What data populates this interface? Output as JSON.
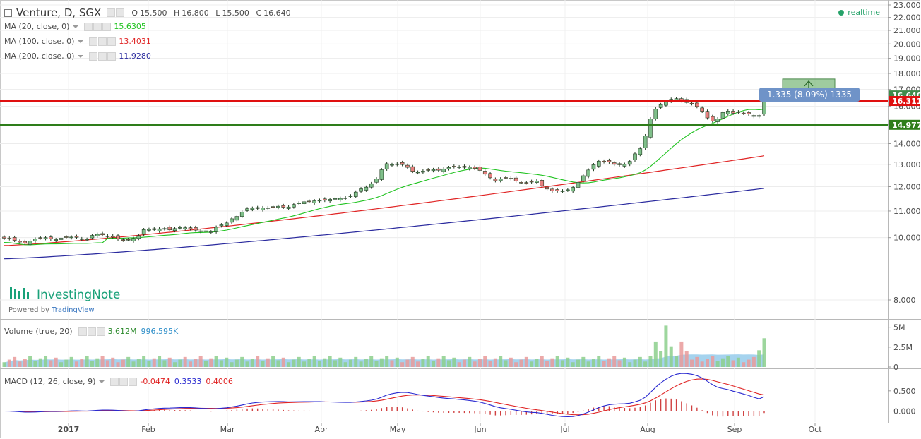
{
  "header": {
    "symbol": "Venture, D, SGX",
    "open_label": "O",
    "open": "15.500",
    "high_label": "H",
    "high": "16.800",
    "low_label": "L",
    "low": "15.500",
    "close_label": "C",
    "close": "16.640",
    "realtime": "realtime"
  },
  "indicators": {
    "ma20": {
      "label": "MA (20, close, 0)",
      "value": "15.6305",
      "color": "#21c321"
    },
    "ma100": {
      "label": "MA (100, close, 0)",
      "value": "13.4031",
      "color": "#e02424"
    },
    "ma200": {
      "label": "MA (200, close, 0)",
      "value": "11.9280",
      "color": "#2a2a9e"
    },
    "volume": {
      "label": "Volume (true, 20)",
      "value1": "3.612M",
      "value2": "996.595K",
      "value1_color": "#2e8b2e",
      "value2_color": "#2f8fc9"
    },
    "macd": {
      "label": "MACD (12, 26, close, 9)",
      "hist": "-0.0474",
      "macd": "0.3533",
      "signal": "0.4006",
      "hist_color": "#e02424",
      "macd_color": "#2a2ad0",
      "signal_color": "#e02424"
    }
  },
  "branding": {
    "name": "InvestingNote",
    "powered_prefix": "Powered by",
    "powered_link": "TradingView"
  },
  "colors": {
    "up": "#7fbf8a",
    "down": "#e88080",
    "candle_border": "#1e3a1e",
    "resistance": "#e01010",
    "support": "#2e7d1a",
    "measure": "#7fb97f",
    "measure_label_bg": "#6f93c8"
  },
  "chart_data": [
    {
      "type": "candlestick",
      "title": "Venture, D, SGX",
      "x_ticks": [
        "2017",
        "Feb",
        "Mar",
        "Apr",
        "May",
        "Jun",
        "Jul",
        "Aug",
        "Sep",
        "Oct"
      ],
      "y_ticks": [
        "8.000",
        "10.000",
        "11.000",
        "12.000",
        "13.000",
        "14.000",
        "15.000",
        "16.000",
        "17.000",
        "18.000",
        "19.000",
        "20.000",
        "21.000",
        "22.000",
        "23.000"
      ],
      "y_scale": "log",
      "ylim": [
        7.5,
        23.0
      ],
      "price_labels": {
        "last": "16.640",
        "resistance": "16.311",
        "support": "14.977"
      },
      "horizontal_lines": [
        16.311,
        14.977
      ],
      "measure": {
        "label": "1.335 (8.09%) 1335",
        "from": 16.311,
        "to": 17.646
      },
      "closes": [
        9.98,
        9.96,
        9.9,
        9.84,
        9.8,
        9.88,
        9.95,
        9.99,
        10.0,
        9.95,
        9.93,
        9.98,
        10.02,
        10.02,
        10.01,
        9.94,
        9.94,
        10.08,
        10.12,
        10.1,
        10.06,
        10.02,
        9.95,
        9.91,
        9.93,
        9.97,
        10.07,
        10.29,
        10.3,
        10.29,
        10.32,
        10.33,
        10.28,
        10.33,
        10.37,
        10.36,
        10.32,
        10.27,
        10.22,
        10.24,
        10.21,
        10.38,
        10.47,
        10.54,
        10.7,
        10.79,
        10.96,
        11.09,
        11.11,
        11.1,
        11.13,
        11.12,
        11.17,
        11.19,
        11.15,
        11.16,
        11.26,
        11.32,
        11.37,
        11.38,
        11.41,
        11.43,
        11.43,
        11.47,
        11.5,
        11.51,
        11.53,
        11.61,
        11.77,
        11.91,
        11.98,
        12.13,
        12.34,
        12.75,
        13.03,
        12.99,
        13.02,
        12.99,
        12.86,
        12.68,
        12.64,
        12.69,
        12.74,
        12.76,
        12.73,
        12.79,
        12.85,
        12.89,
        12.88,
        12.86,
        12.87,
        12.81,
        12.72,
        12.55,
        12.39,
        12.26,
        12.34,
        12.4,
        12.35,
        12.25,
        12.18,
        12.17,
        12.21,
        12.25,
        12.04,
        11.9,
        11.82,
        11.82,
        11.82,
        11.87,
        11.97,
        12.19,
        12.48,
        12.74,
        12.98,
        13.15,
        13.12,
        13.11,
        13.0,
        12.98,
        13.0,
        13.14,
        13.5,
        13.75,
        14.4,
        15.3,
        15.85,
        16.1,
        16.25,
        16.41,
        16.45,
        16.32,
        16.22,
        16.15,
        15.99,
        15.72,
        15.35,
        15.18,
        15.3,
        15.65,
        15.73,
        15.61,
        15.66,
        15.61,
        15.56,
        15.43,
        15.48,
        16.64
      ],
      "ma20": {
        "name": "MA (20, close, 0)",
        "last": 15.6305
      },
      "ma100": {
        "name": "MA (100, close, 0)",
        "last": 13.4031
      },
      "ma200": {
        "name": "MA (200, close, 0)",
        "last": 11.928
      }
    },
    {
      "type": "bar",
      "title": "Volume (true, 20)",
      "y_ticks": [
        "0",
        "2.5M",
        "5M"
      ],
      "ylim": [
        0,
        5.5
      ],
      "last_volume_millions": 3.612,
      "ma_last_millions": 0.997,
      "peaks_millions": {
        "Aug_spike": 5.2,
        "Sep_last": 3.612
      }
    },
    {
      "type": "line",
      "title": "MACD (12, 26, close, 9)",
      "y_ticks": [
        "0.000",
        "0.500"
      ],
      "ylim": [
        -0.2,
        0.95
      ],
      "last": {
        "histogram": -0.0474,
        "macd": 0.3533,
        "signal": 0.4006
      },
      "peak": {
        "macd": 0.93,
        "signal": 0.86
      }
    }
  ]
}
